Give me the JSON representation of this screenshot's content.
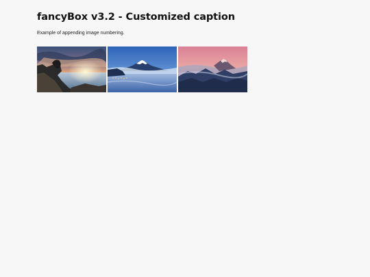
{
  "header": {
    "title": "fancyBox v3.2 - Customized caption",
    "description": "Example of appending image numbering."
  },
  "gallery": {
    "thumbnails": [
      {
        "name": "thumbnail-coastal-sunset",
        "depicts": "rocky coast at sunset"
      },
      {
        "name": "thumbnail-mount-fuji",
        "depicts": "snow-capped mountain over misty lake"
      },
      {
        "name": "thumbnail-mountain-range",
        "depicts": "mountain peaks above clouds at dusk"
      }
    ]
  },
  "colors": {
    "background": "#f7f7f7",
    "title": "#111111"
  }
}
